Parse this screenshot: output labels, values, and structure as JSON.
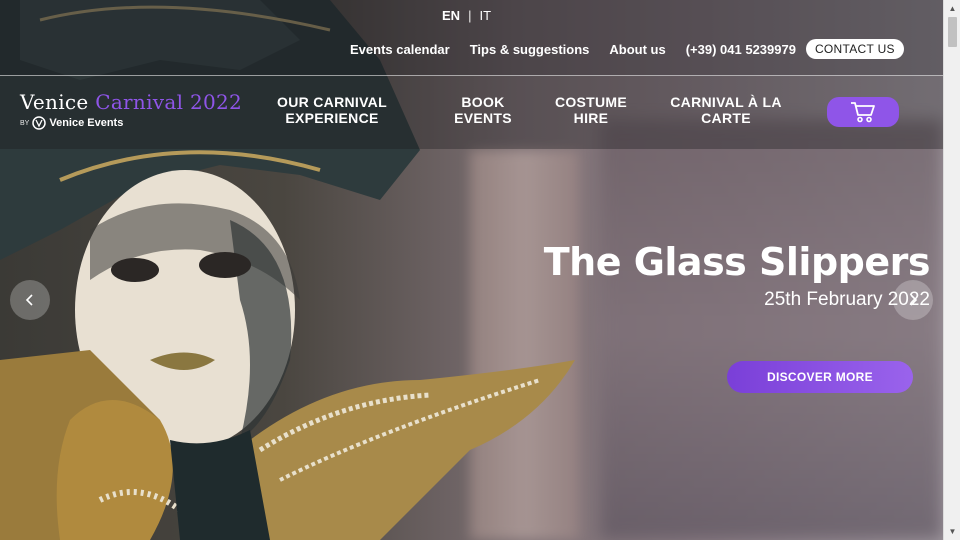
{
  "language": {
    "active": "EN",
    "separator": "|",
    "other": "IT"
  },
  "top_links": {
    "events_calendar": "Events calendar",
    "tips": "Tips & suggestions",
    "about": "About us",
    "phone": "(+39) 041 5239979",
    "contact": "CONTACT US"
  },
  "logo": {
    "name_part1": "Venice ",
    "name_part2": "Carnival 2022",
    "by": "BY",
    "brand": "Venice Events"
  },
  "nav": {
    "experience": "OUR CARNIVAL EXPERIENCE",
    "book": "BOOK EVENTS",
    "costume": "COSTUME HIRE",
    "carte": "CARNIVAL À LA CARTE"
  },
  "slide": {
    "title": "The Glass Slippers",
    "date": "25th February 2022",
    "cta": "DISCOVER MORE"
  },
  "colors": {
    "accent": "#8f55e8",
    "button_gradient_start": "#7a3fd8",
    "button_gradient_end": "#9a63ec"
  },
  "icons": {
    "cart": "shopping-cart-icon",
    "prev": "chevron-left-icon",
    "next": "chevron-right-icon",
    "logo_mark": "venice-events-logo-icon"
  }
}
